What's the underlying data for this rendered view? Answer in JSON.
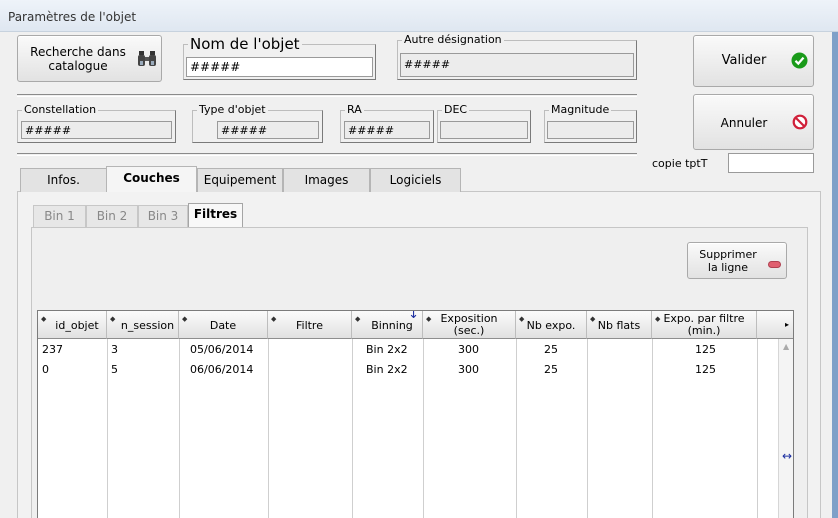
{
  "window": {
    "title": "Paramètres de l'objet"
  },
  "buttons": {
    "search_catalog": "Recherche dans\ncatalogue",
    "validate": "Valider",
    "cancel": "Annuler",
    "delete_row": "Supprimer\nla ligne"
  },
  "fields": {
    "object_name": {
      "label": "Nom de l'objet",
      "value": "#####"
    },
    "other_designation": {
      "label": "Autre désignation",
      "value": "#####"
    },
    "constellation": {
      "label": "Constellation",
      "value": "#####"
    },
    "object_type": {
      "label": "Type d'objet",
      "value": "#####"
    },
    "ra": {
      "label": "RA",
      "value": "#####"
    },
    "dec": {
      "label": "DEC",
      "value": ""
    },
    "magnitude": {
      "label": "Magnitude",
      "value": ""
    },
    "copy_tpt": {
      "label": "copie tptT",
      "value": ""
    }
  },
  "tabs": [
    "Infos.",
    "Couches",
    "Equipement",
    "Images",
    "Logiciels"
  ],
  "active_tab": "Couches",
  "subtabs": [
    "Bin 1",
    "Bin 2",
    "Bin 3",
    "Filtres"
  ],
  "active_subtab": "Filtres",
  "table": {
    "columns": [
      "id_objet",
      "n_session",
      "Date",
      "Filtre",
      "Binning",
      "Exposition\n(sec.)",
      "Nb expo.",
      "Nb flats",
      "Expo. par filtre\n(min.)"
    ],
    "rows": [
      [
        "237",
        "3",
        "05/06/2014",
        "",
        "Bin 2x2",
        "300",
        "25",
        "",
        "125"
      ],
      [
        "0",
        "5",
        "06/06/2014",
        "",
        "Bin 2x2",
        "300",
        "25",
        "",
        "125"
      ]
    ]
  },
  "colors": {
    "validate_icon": "#1a9b1a",
    "cancel_icon": "#d0203a",
    "delete_icon": "#e06070"
  }
}
